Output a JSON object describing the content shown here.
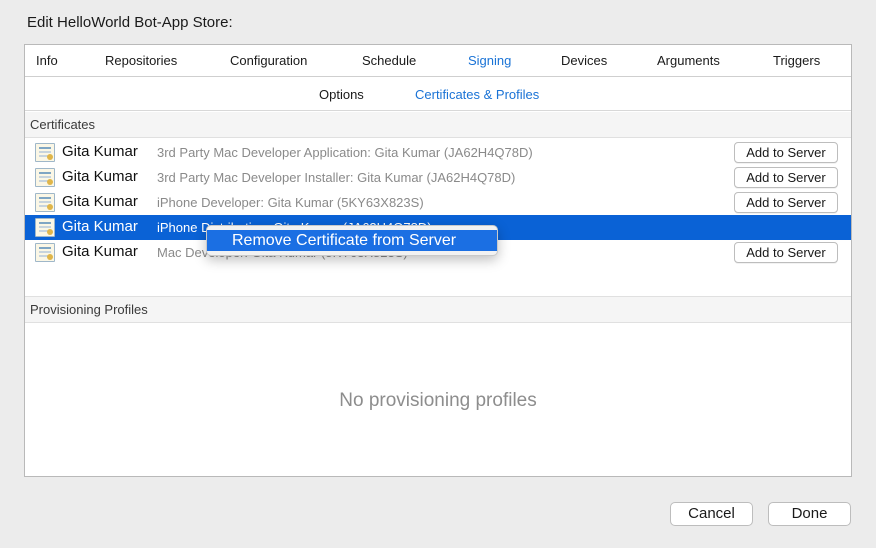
{
  "sheet": {
    "title": "Edit HelloWorld Bot-App Store:"
  },
  "tabs": [
    {
      "label": "Info",
      "active": false
    },
    {
      "label": "Repositories",
      "active": false
    },
    {
      "label": "Configuration",
      "active": false
    },
    {
      "label": "Schedule",
      "active": false
    },
    {
      "label": "Signing",
      "active": true
    },
    {
      "label": "Devices",
      "active": false
    },
    {
      "label": "Arguments",
      "active": false
    },
    {
      "label": "Triggers",
      "active": false
    }
  ],
  "subtabs": [
    {
      "label": "Options",
      "active": false
    },
    {
      "label": "Certificates & Profiles",
      "active": true
    }
  ],
  "certificates": {
    "header": "Certificates",
    "items": [
      {
        "name": "Gita Kumar",
        "description": "3rd Party Mac Developer Application: Gita Kumar (JA62H4Q78D)",
        "button": "Add to Server",
        "selected": false
      },
      {
        "name": "Gita Kumar",
        "description": "3rd Party Mac Developer Installer: Gita Kumar (JA62H4Q78D)",
        "button": "Add to Server",
        "selected": false
      },
      {
        "name": "Gita Kumar",
        "description": "iPhone Developer: Gita Kumar (5KY63X823S)",
        "button": "Add to Server",
        "selected": false
      },
      {
        "name": "Gita Kumar",
        "description": "iPhone Distribution: Gita Kumar (JA62H4Q78D)",
        "button": "",
        "selected": true
      },
      {
        "name": "Gita Kumar",
        "description": "Mac Developer: Gita Kumar (5KY63X823S)",
        "button": "Add to Server",
        "selected": false
      }
    ]
  },
  "provisioning": {
    "header": "Provisioning Profiles",
    "empty_message": "No provisioning profiles"
  },
  "context_menu": {
    "item": "Remove Certificate from Server"
  },
  "footer": {
    "cancel_label": "Cancel",
    "done_label": "Done"
  },
  "colors": {
    "accent": "#1a73d6",
    "selection": "#0a62d6"
  },
  "icons": {
    "certificate": "certificate-icon"
  }
}
